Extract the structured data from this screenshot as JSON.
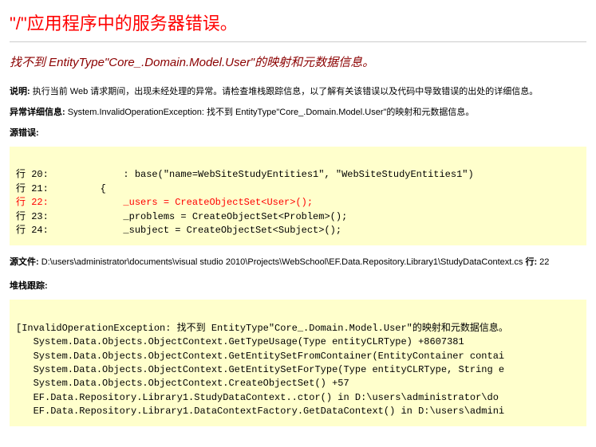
{
  "title": "\"/\"应用程序中的服务器错误。",
  "subtitle": "找不到 EntityType\"Core_.Domain.Model.User\"的映射和元数据信息。",
  "desc_label": "说明:",
  "desc_text": " 执行当前 Web 请求期间，出现未经处理的异常。请检查堆栈跟踪信息，以了解有关该错误以及代码中导致错误的出处的详细信息。",
  "exc_label": "异常详细信息:",
  "exc_text": " System.InvalidOperationException: 找不到 EntityType\"Core_.Domain.Model.User\"的映射和元数据信息。",
  "src_err_label": "源错误:",
  "code_pre": "\n行 20:             : base(\"name=WebSiteStudyEntities1\", \"WebSiteStudyEntities1\")\n行 21:         {",
  "code_err": "行 22:             _users = CreateObjectSet<User>();",
  "code_post": "行 23:             _problems = CreateObjectSet<Problem>();\n行 24:             _subject = CreateObjectSet<Subject>();\n",
  "src_file_label": "源文件:",
  "src_file": " D:\\users\\administrator\\documents\\visual studio 2010\\Projects\\WebSchool\\EF.Data.Repository.Library1\\StudyDataContext.cs",
  "line_label": "    行:",
  "line_num": " 22",
  "stack_label": "堆栈跟踪:",
  "stack": "\n[InvalidOperationException: 找不到 EntityType\"Core_.Domain.Model.User\"的映射和元数据信息。\n   System.Data.Objects.ObjectContext.GetTypeUsage(Type entityCLRType) +8607381\n   System.Data.Objects.ObjectContext.GetEntitySetFromContainer(EntityContainer contai\n   System.Data.Objects.ObjectContext.GetEntitySetForType(Type entityCLRType, String e\n   System.Data.Objects.ObjectContext.CreateObjectSet() +57\n   EF.Data.Repository.Library1.StudyDataContext..ctor() in D:\\users\\administrator\\do\n   EF.Data.Repository.Library1.DataContextFactory.GetDataContext() in D:\\users\\admini"
}
